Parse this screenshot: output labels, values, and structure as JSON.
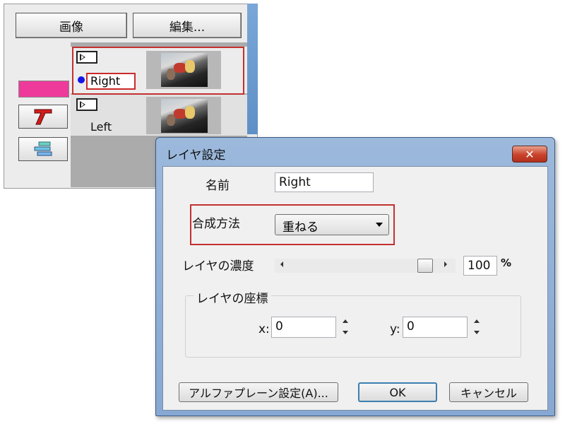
{
  "panel": {
    "image_button": "画像",
    "edit_button": "編集...",
    "layers": [
      {
        "name": "Right"
      },
      {
        "name": "Left"
      }
    ],
    "color_swatch": "#ee3a9b",
    "tools": [
      {
        "icon": "text-tool-icon"
      },
      {
        "icon": "layer-stack-icon"
      }
    ]
  },
  "dialog": {
    "title": "レイヤ設定",
    "close_label": "✕",
    "name_label": "名前",
    "name_value": "Right",
    "blend_label": "合成方法",
    "blend_value": "重ねる",
    "opacity_label": "レイヤの濃度",
    "opacity_value": "100",
    "opacity_fraction": 1.0,
    "opacity_unit": "%",
    "coords_label": "レイヤの座標",
    "x_label": "x:",
    "x_value": "0",
    "y_label": "y:",
    "y_value": "0",
    "alpha_button": "アルファプレーン設定(A)...",
    "ok_button": "OK",
    "cancel_button": "キャンセル"
  },
  "colors": {
    "highlight_red": "#c43030",
    "dialog_frame": "#87a8d2",
    "close_red": "#c9422b"
  }
}
